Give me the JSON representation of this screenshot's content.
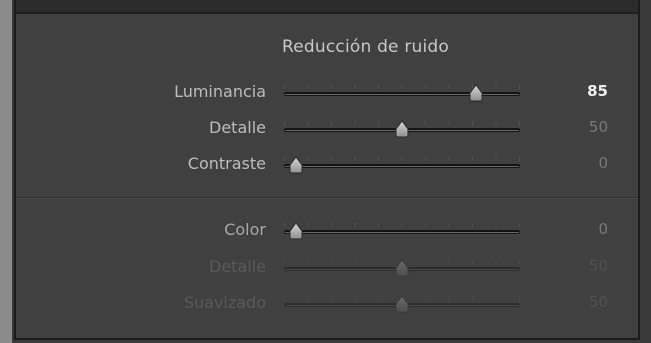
{
  "panel": {
    "title": "Reducción de ruido"
  },
  "sliders": [
    {
      "label": "Luminancia",
      "value": "85",
      "level": 0.85,
      "state": "active"
    },
    {
      "label": "Detalle",
      "value": "50",
      "level": 0.5,
      "state": "normal"
    },
    {
      "label": "Contraste",
      "value": "0",
      "level": 0.0,
      "state": "normal"
    },
    {
      "label": "Color",
      "value": "0",
      "level": 0.0,
      "state": "muted"
    },
    {
      "label": "Detalle",
      "value": "50",
      "level": 0.5,
      "state": "disabled"
    },
    {
      "label": "Suavizado",
      "value": "50",
      "level": 0.5,
      "state": "disabled"
    }
  ],
  "colors": {
    "panel_bg": "#404040",
    "label_text": "#bdbdbd",
    "active_value": "#f2f2f2",
    "disabled_text": "#5b5b5b"
  }
}
